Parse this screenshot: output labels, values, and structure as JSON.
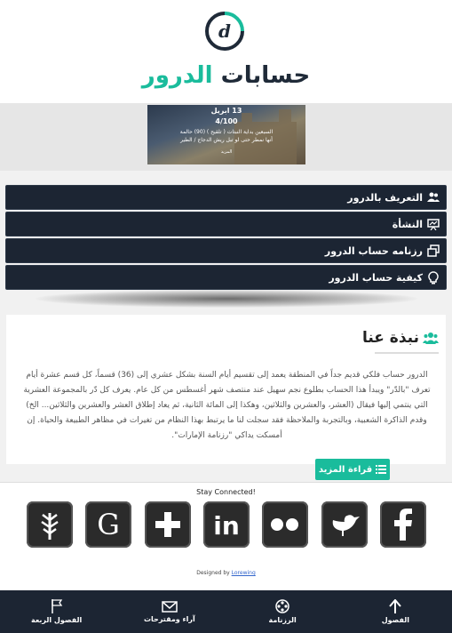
{
  "header": {
    "title_dark": "حسابات",
    "title_accent": "الدرور",
    "logo_letter": "d",
    "accent_color": "#1abc9c",
    "dark_color": "#1f2a38"
  },
  "banner": {
    "date": "13 ابريل",
    "count": "4/100",
    "line1": "السبعين بداية النبتات ( تلقيح ) (90) حالمة",
    "line2": "أنها نمطر حتى لو تبل ريش الدجاج / الطير",
    "more": "المزيد"
  },
  "menu": {
    "items": [
      {
        "label": "التعريف بالدرور",
        "icon": "users-icon"
      },
      {
        "label": "النشأة",
        "icon": "presentation-icon"
      },
      {
        "label": "رزنامه حساب الدرور",
        "icon": "window-restore-icon"
      },
      {
        "label": "كيفية حساب الدرور",
        "icon": "lightbulb-icon"
      }
    ]
  },
  "about": {
    "title": "نبذة عنا",
    "text": "الدرور حساب فلكي قديم جداً في المنطقة يعمد إلى تقسيم أيام السنة بشكل عشري إلى (36) قسماً، كل قسم عشرة أيام تعرف \"بالدّر\" ويبدأ هذا الحساب بطلوع نجم سهيل عند منتصف شهر أغسطس من كل عام. يعرف كل دّر بالمجموعة العشرية التي ينتمي إليها فيقال (العشر، والعشرين والثلاثين، وهكذا إلى المائة الثانية، ثم يعاد إطلاق العشر والعشرين والثلاثين... الخ) وقدم الذاكرة الشعبية، وبالتجربة والملاحظة فقد سجلت لنا ما يرتبط بهذا النظام من تغيرات في مظاهر الطبيعة والحياة. إن أمسكت يداكي \"رزنامة الإمارات\"."
  },
  "read_more": {
    "label": "قراءة المزيد"
  },
  "social": {
    "stay_connected": "Stay Connected!",
    "icons": [
      "vine-icon",
      "google-icon",
      "google-plus-icon",
      "linkedin-icon",
      "flickr-icon",
      "twitter-icon",
      "facebook-icon"
    ],
    "designed_by": "Designed by",
    "designer": "Lorewing"
  },
  "bottom_nav": {
    "items": [
      {
        "label": "الفصول الربعة",
        "icon": "flag-icon"
      },
      {
        "label": "آراء ومقترحات",
        "icon": "envelope-icon"
      },
      {
        "label": "الرزنامة",
        "icon": "film-reel-icon"
      },
      {
        "label": "الفصول",
        "icon": "arrow-up-icon"
      }
    ]
  }
}
